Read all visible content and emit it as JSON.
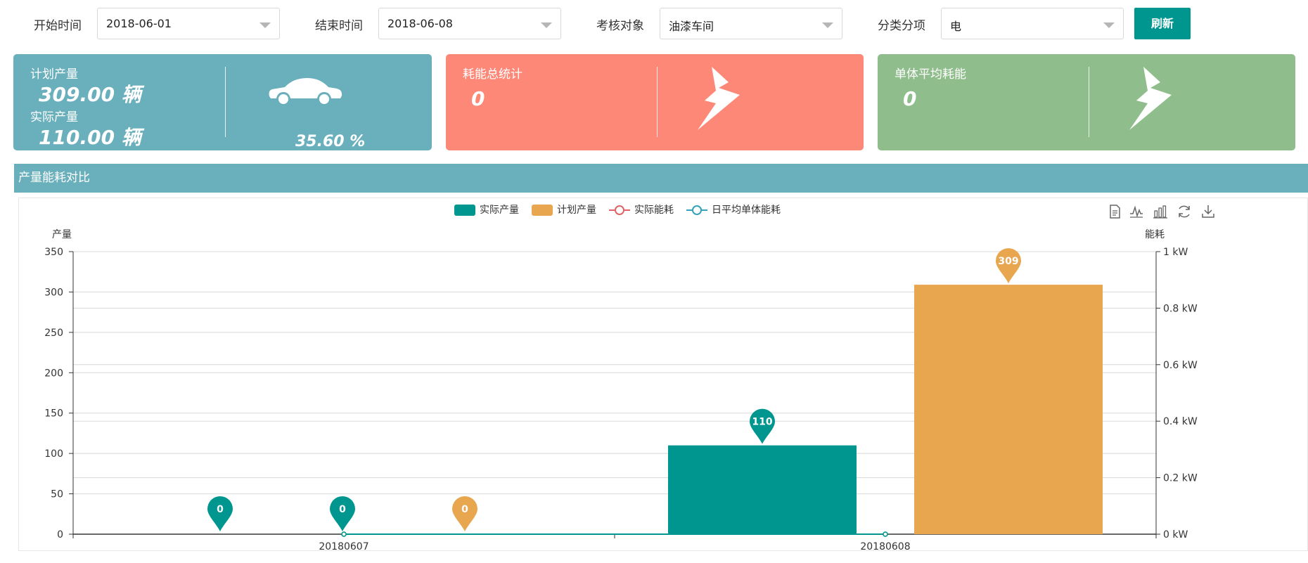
{
  "filters": {
    "start_label": "开始时间",
    "start_value": "2018-06-01",
    "end_label": "结束时间",
    "end_value": "2018-06-08",
    "target_label": "考核对象",
    "target_value": "油漆车间",
    "category_label": "分类分项",
    "category_value": "电",
    "refresh_label": "刷新"
  },
  "cards": {
    "production": {
      "color": "#6aafbc",
      "planned_label": "计划产量",
      "planned_value": "309.00 辆",
      "actual_label": "实际产量",
      "actual_value": "110.00 辆",
      "percent": "35.60 %",
      "icon": "car-icon"
    },
    "energy_total": {
      "color": "#fd8877",
      "label": "耗能总统计",
      "value": "0",
      "icon": "lightning-icon"
    },
    "unit_avg": {
      "color": "#8fbe8c",
      "label": "单体平均耗能",
      "value": "0",
      "icon": "lightning-icon"
    }
  },
  "section": {
    "title": "产量能耗对比"
  },
  "toolbox": [
    "data-view-icon",
    "line-chart-icon",
    "bar-chart-icon",
    "restore-icon",
    "download-icon"
  ],
  "chart_data": {
    "type": "bar",
    "categories": [
      "20180607",
      "20180608"
    ],
    "series": [
      {
        "name": "实际产量",
        "type": "bar",
        "color": "#009690",
        "values": [
          0,
          110
        ]
      },
      {
        "name": "计划产量",
        "type": "bar",
        "color": "#e8a74f",
        "values": [
          0,
          309
        ]
      },
      {
        "name": "实际能耗",
        "type": "line",
        "color": "#e06467",
        "values": [
          0,
          0
        ]
      },
      {
        "name": "日平均单体能耗",
        "type": "line",
        "color": "#33a2ba",
        "values": [
          0,
          0
        ]
      }
    ],
    "ylabel_left": "产量",
    "ylabel_right": "能耗",
    "ylim_left": [
      0,
      350
    ],
    "yticks_left": [
      "0",
      "50",
      "100",
      "150",
      "200",
      "250",
      "300",
      "350"
    ],
    "ylim_right": [
      0,
      1
    ],
    "yticks_right": [
      "0 kW",
      "0.2 kW",
      "0.4 kW",
      "0.6 kW",
      "0.8 kW",
      "1 kW"
    ],
    "markers": [
      {
        "series": 0,
        "category": 0,
        "label": "0"
      },
      {
        "series": 1,
        "category": 0,
        "label": "0"
      },
      {
        "series": 0,
        "category": 1,
        "label": "110"
      },
      {
        "series": 1,
        "category": 1,
        "label": "309"
      }
    ],
    "grid": true,
    "legend_position": "top-center"
  }
}
